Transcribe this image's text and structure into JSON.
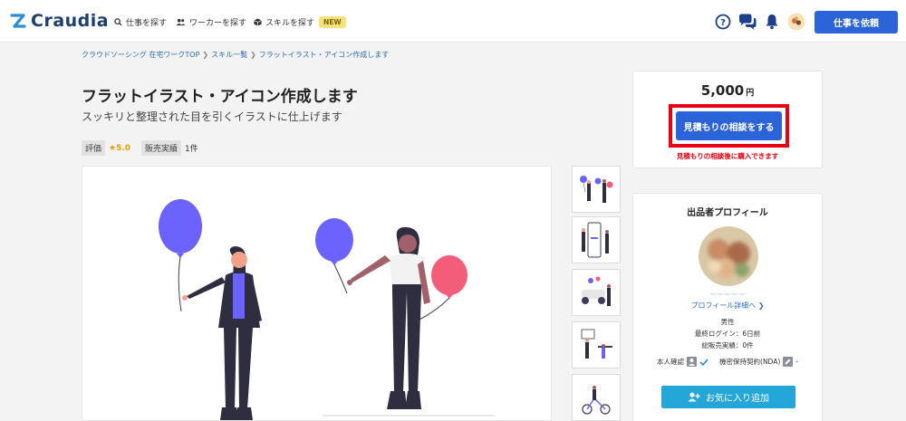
{
  "header": {
    "logo_text": "Craudia",
    "nav": [
      {
        "label": "仕事を探す",
        "icon": "search-icon"
      },
      {
        "label": "ワーカーを探す",
        "icon": "users-icon"
      },
      {
        "label": "スキルを探す",
        "icon": "cube-icon",
        "badge": "NEW"
      }
    ],
    "icons": [
      "help-icon",
      "chat-icon",
      "bell-icon",
      "user-avatar"
    ],
    "post_job_label": "仕事を依頼"
  },
  "breadcrumb": [
    "クラウドソーシング 在宅ワークTOP",
    "スキル一覧",
    "フラットイラスト・アイコン作成します"
  ],
  "service": {
    "title": "フラットイラスト・アイコン作成します",
    "subtitle": "スッキリと整理された目を引くイラストに仕上げます",
    "rating_label": "評価",
    "rating_value": "★5.0",
    "sales_label": "販売実績",
    "sales_value": "1件"
  },
  "price_card": {
    "price": "5,000",
    "currency": "円",
    "quote_button": "見積もりの相談をする",
    "note": "見積もりの相談後に購入できます",
    "highlight_color": "#e60012"
  },
  "profile": {
    "heading": "出品者プロフィール",
    "name": "ーーーーー",
    "link": "プロフィール詳細へ",
    "gender": "男性",
    "last_login": "最終ログイン：6日前",
    "total_sales": "総販売実績：0件",
    "identity_label": "本人確認",
    "nda_label": "機密保持契約(NDA)",
    "nda_value": "-",
    "favorite_button": "お気に入り追加"
  },
  "colors": {
    "primary": "#2b63d9",
    "favorite": "#25a6d9",
    "balloon_purple": "#6c63ff",
    "balloon_pink": "#f45d7a"
  }
}
